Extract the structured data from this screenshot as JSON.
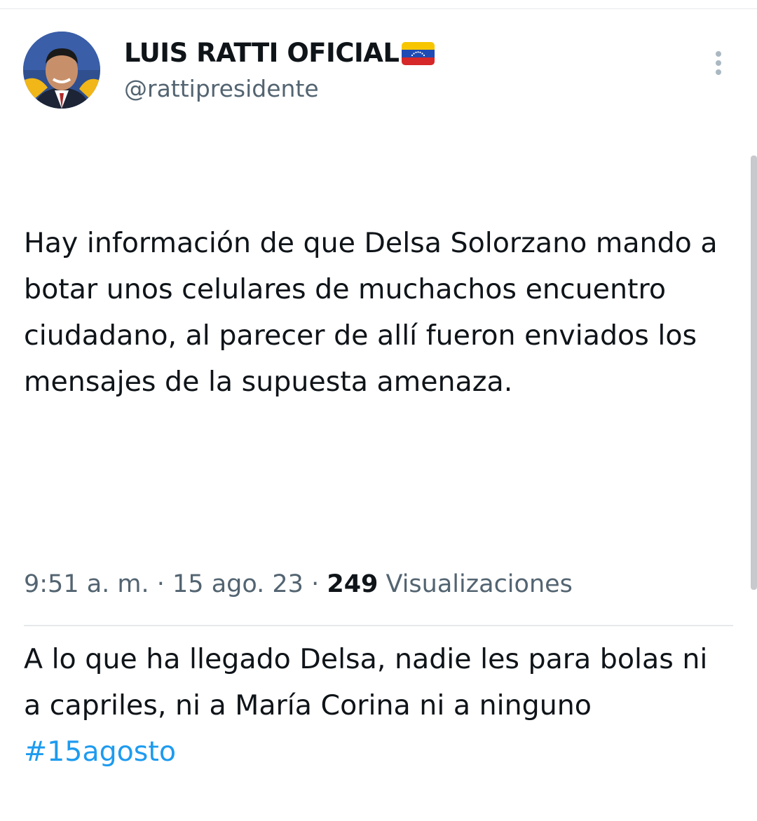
{
  "author": {
    "display_name": "LUIS RATTI OFICIAL",
    "handle": "@rattipresidente",
    "avatar_icon": "profile-photo",
    "flag_icon": "venezuela-flag"
  },
  "tweet": {
    "paragraph_1": "Hay información de que Delsa Solorzano mando a botar unos celulares de muchachos encuentro ciudadano, al parecer de allí fueron enviados los mensajes de la supuesta amenaza.",
    "paragraph_2": "A lo que ha llegado Delsa, nadie les para bolas ni a capriles, ni a María Corina ni a ninguno ",
    "hashtag": "#15agosto"
  },
  "meta": {
    "time": "9:51 a. m.",
    "separator": " · ",
    "date": "15 ago. 23",
    "views_count": "249",
    "views_label": " Visualizaciones"
  },
  "colors": {
    "text": "#0f1419",
    "secondary": "#536471",
    "link": "#1d9bf0",
    "divider": "#e6e9ec"
  }
}
